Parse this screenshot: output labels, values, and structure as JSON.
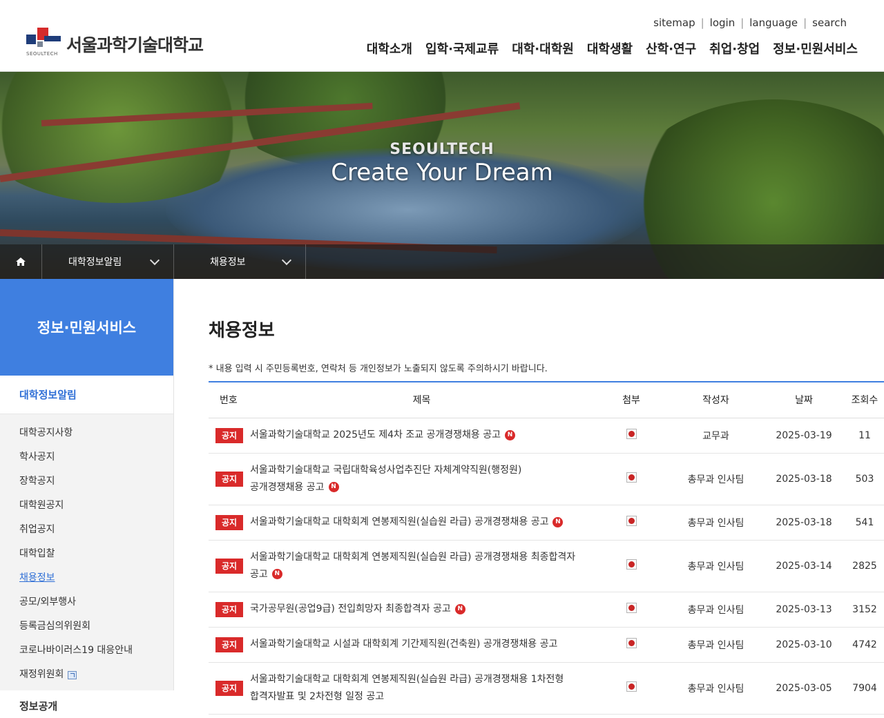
{
  "header": {
    "logo_name": "서울과학기술대학교",
    "logo_caption": "SEOULTECH",
    "util_links": [
      "sitemap",
      "login",
      "language",
      "search"
    ],
    "gnb": [
      "대학소개",
      "입학·국제교류",
      "대학·대학원",
      "대학생활",
      "산학·연구",
      "취업·창업",
      "정보·민원서비스"
    ]
  },
  "banner": {
    "line1": "SEOULTECH",
    "line2": "Create Your Dream"
  },
  "location": {
    "level1": "대학정보알림",
    "level2": "채용정보"
  },
  "sidebar": {
    "title": "정보·민원서비스",
    "section": "대학정보알림",
    "items": [
      "대학공지사항",
      "학사공지",
      "장학공지",
      "대학원공지",
      "취업공지",
      "대학입찰",
      "채용정보",
      "공모/외부행사",
      "등록금심의위원회",
      "코로나바이러스19 대응안내",
      "재정위원회"
    ],
    "next_section": "정보공개"
  },
  "main": {
    "title": "채용정보",
    "notice": "* 내용 입력 시 주민등록번호, 연락처 등 개인정보가 노출되지 않도록 주의하시기 바랍니다.",
    "columns": [
      "번호",
      "제목",
      "첨부",
      "작성자",
      "날짜",
      "조회수"
    ],
    "rows": [
      {
        "badge": "공지",
        "title_line1": "서울과학기술대학교 2025년도 제4차 조교 공개경쟁채용 공고",
        "title_line2": "",
        "new": "N",
        "author": "교무과",
        "date": "2025-03-19",
        "views": "11"
      },
      {
        "badge": "공지",
        "title_line1": "서울과학기술대학교 국립대학육성사업추진단 자체계약직원(행정원)",
        "title_line2": "공개경쟁채용 공고",
        "new": "N",
        "author": "총무과 인사팀",
        "date": "2025-03-18",
        "views": "503"
      },
      {
        "badge": "공지",
        "title_line1": "서울과학기술대학교 대학회계 연봉제직원(실습원 라급) 공개경쟁채용 공고",
        "title_line2": "",
        "new": "N",
        "author": "총무과 인사팀",
        "date": "2025-03-18",
        "views": "541"
      },
      {
        "badge": "공지",
        "title_line1": "서울과학기술대학교 대학회계 연봉제직원(실습원 라급) 공개경쟁채용 최종합격자",
        "title_line2": "공고",
        "new": "N",
        "author": "총무과 인사팀",
        "date": "2025-03-14",
        "views": "2825"
      },
      {
        "badge": "공지",
        "title_line1": "국가공무원(공업9급) 전입희망자 최종합격자 공고",
        "title_line2": "",
        "new": "N",
        "author": "총무과 인사팀",
        "date": "2025-03-13",
        "views": "3152"
      },
      {
        "badge": "공지",
        "title_line1": "서울과학기술대학교 시설과 대학회계 기간제직원(건축원) 공개경쟁채용 공고",
        "title_line2": "",
        "new": "",
        "author": "총무과 인사팀",
        "date": "2025-03-10",
        "views": "4742"
      },
      {
        "badge": "공지",
        "title_line1": "서울과학기술대학교 대학회계 연봉제직원(실습원 라급) 공개경쟁채용 1차전형",
        "title_line2": "합격자발표 및 2차전형 일정 공고",
        "new": "",
        "author": "총무과 인사팀",
        "date": "2025-03-05",
        "views": "7904"
      }
    ]
  }
}
